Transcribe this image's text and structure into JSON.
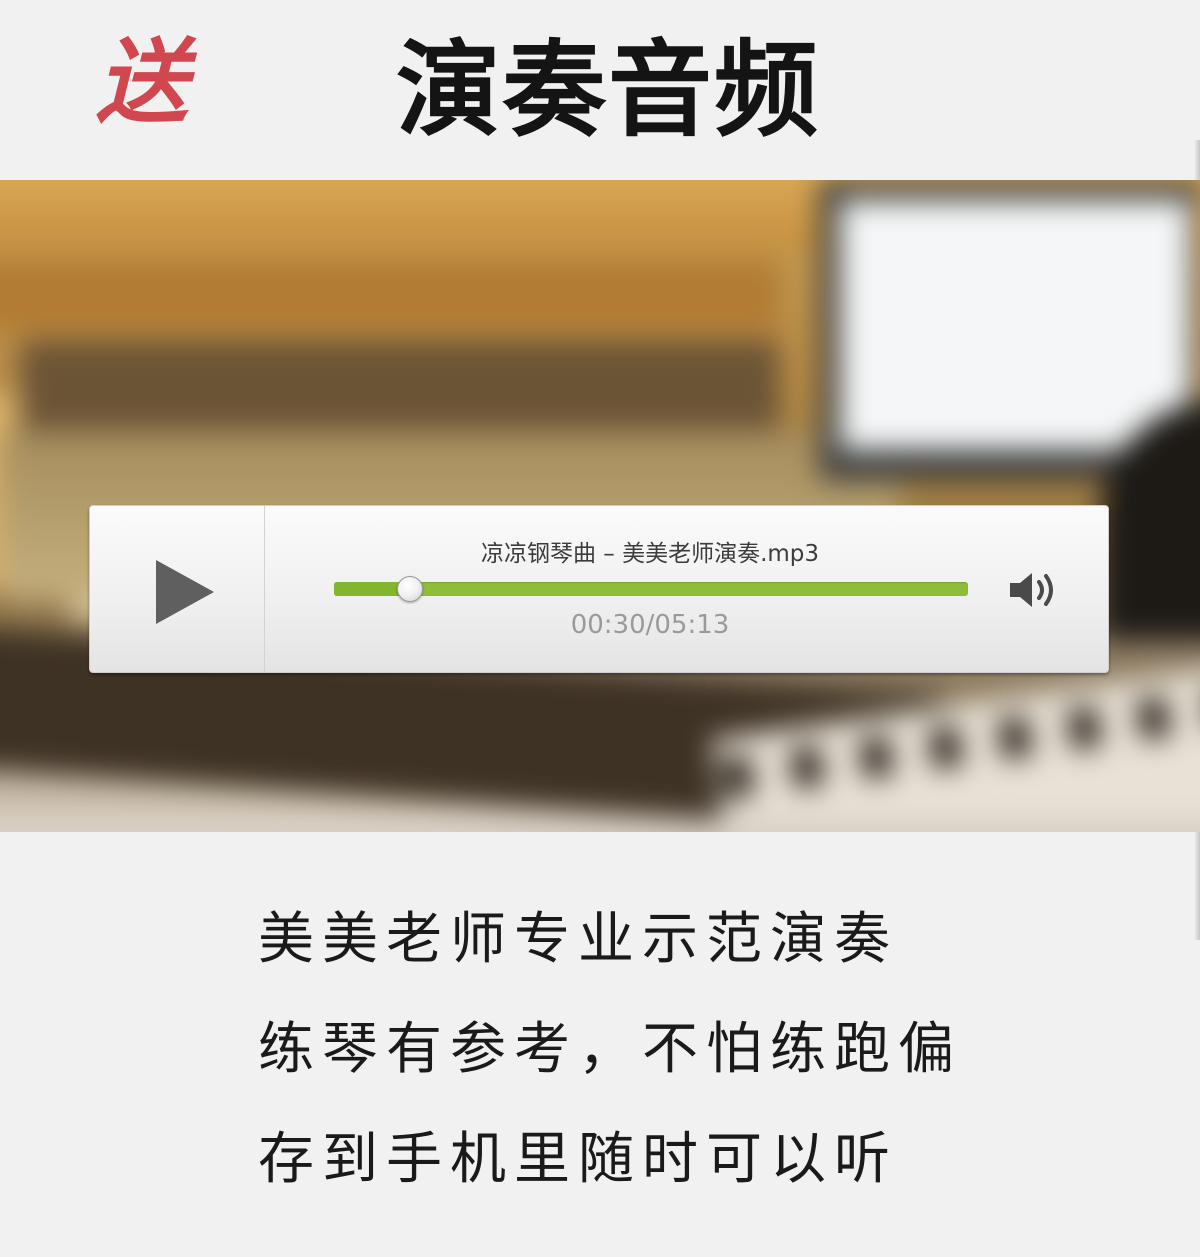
{
  "header": {
    "badge": "送",
    "title": "演奏音频"
  },
  "player": {
    "track_title": "凉凉钢琴曲 – 美美老师演奏.mp3",
    "time_display": "00:30/05:13",
    "progress_fraction": 0.118,
    "play_icon": "play-icon",
    "volume_icon": "speaker-icon",
    "accent_color": "#83b52d"
  },
  "description": {
    "line1": "美美老师专业示范演奏",
    "line2": "练琴有参考，不怕练跑偏",
    "line3": "存到手机里随时可以听"
  }
}
